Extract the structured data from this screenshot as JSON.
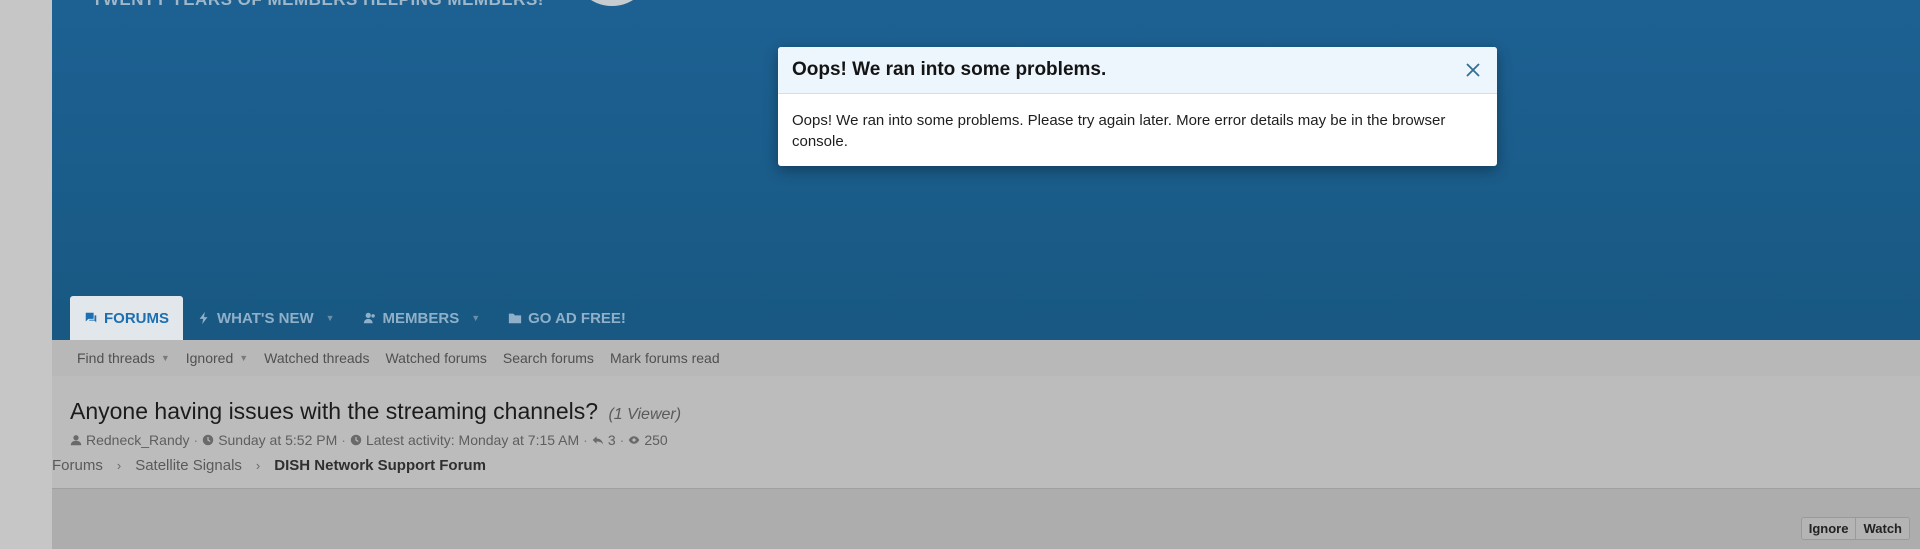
{
  "header": {
    "tagline": "TWENTY YEARS OF MEMBERS HELPING MEMBERS!"
  },
  "nav": {
    "tabs": [
      {
        "label": "FORUMS",
        "icon": "chat-icon",
        "active": true
      },
      {
        "label": "WHAT'S NEW",
        "icon": "bolt-icon",
        "dropdown": true
      },
      {
        "label": "MEMBERS",
        "icon": "users-icon",
        "dropdown": true
      },
      {
        "label": "GO AD FREE!",
        "icon": "folder-icon"
      }
    ]
  },
  "subnav": {
    "items": [
      "Find threads",
      "Ignored",
      "Watched threads",
      "Watched forums",
      "Search forums",
      "Mark forums read"
    ]
  },
  "thread": {
    "title": "Anyone having issues with the streaming channels?",
    "viewers": "(1 Viewer)",
    "author": "Redneck_Randy",
    "started": "Sunday at 5:52 PM",
    "latest_activity": "Latest activity: Monday at 7:15 AM",
    "replies": "3",
    "views": "250"
  },
  "breadcrumb": [
    "Forums",
    "Satellite Signals",
    "DISH Network Support Forum"
  ],
  "actions": {
    "ignore": "Ignore",
    "watch": "Watch"
  },
  "modal": {
    "title": "Oops! We ran into some problems.",
    "body": "Oops! We ran into some problems. Please try again later. More error details may be in the browser console."
  },
  "colors": {
    "header_bg": "#1d6193",
    "accent": "#1d6fb0",
    "modal_head_bg": "#edf5fd"
  }
}
